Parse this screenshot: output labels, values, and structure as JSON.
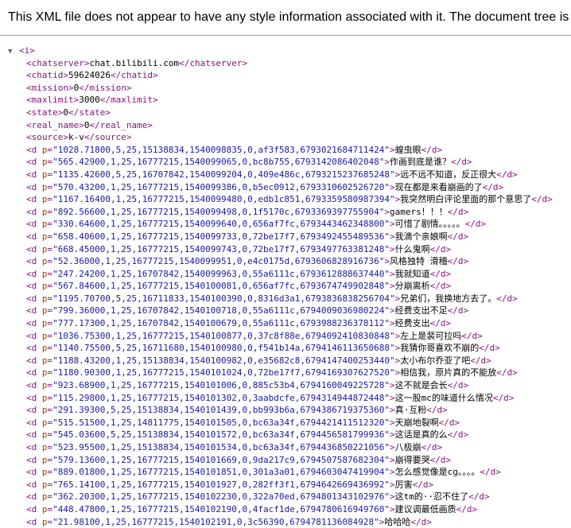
{
  "notice": "This XML file does not appear to have any style information associated with it. The document tree is shown below.",
  "root": {
    "open": "<i>",
    "toggle": "▼"
  },
  "fields": [
    {
      "tag": "chatserver",
      "value": "chat.bilibili.com"
    },
    {
      "tag": "chatid",
      "value": "59624026"
    },
    {
      "tag": "mission",
      "value": "0"
    },
    {
      "tag": "maxlimit",
      "value": "3000"
    },
    {
      "tag": "state",
      "value": "0"
    },
    {
      "tag": "real_name",
      "value": "0"
    },
    {
      "tag": "source",
      "value": "k-v"
    }
  ],
  "danmaku": [
    {
      "p": "1028.71800,5,25,15138834,1540098835,0,af3f583,6793021684711424",
      "text": "蝗虫眼"
    },
    {
      "p": "565.42900,1,25,16777215,1540099065,0,bc8b755,6793142086402048",
      "text": "作画到底是谁？"
    },
    {
      "p": "1135.42600,5,25,16707842,1540099204,0,409e486c,6793215237685248",
      "text": "远不远不知道，反正很大"
    },
    {
      "p": "570.43200,1,25,16777215,1540099386,0,b5ec0912,6793310602526720",
      "text": "现在都是来看崩画的了"
    },
    {
      "p": "1167.16400,1,25,16777215,1540099480,0,edb1c851,6793359580987394",
      "text": "我突然明白评论里面的那个意思了"
    },
    {
      "p": "892.56600,1,25,16777215,1540099498,0,1f5170c,6793369397755904",
      "text": "gamers！！！"
    },
    {
      "p": "330.64600,1,25,16777215,1540099640,0,656af7fc,6793443462348800",
      "text": "可惜了剧情。。。。。"
    },
    {
      "p": "658.40600,1,25,16777215,1540099733,0,72be17f7,6793492455489536",
      "text": "我滴个亲娘啊"
    },
    {
      "p": "668.45000,1,25,16777215,1540099743,0,72be17f7,6793497763381248",
      "text": "什么鬼啊"
    },
    {
      "p": "52.36000,1,25,16777215,1540099951,0,e4c0175d,6793606828916736",
      "text": "风格独特 滑稽"
    },
    {
      "p": "247.24200,1,25,16707842,1540099963,0,55a6111c,6793612888637440",
      "text": "我就知道"
    },
    {
      "p": "567.84600,1,25,16777215,1540100081,0,656af7fc,6793674749902848",
      "text": "分崩离析"
    },
    {
      "p": "1195.70700,5,25,16711833,1540100390,0,8316d3a1,6793836838256704",
      "text": "兄弟们，我换地方去了。"
    },
    {
      "p": "799.36000,1,25,16707842,1540100718,0,55a6111c,6794009036980224",
      "text": "经费支出不足"
    },
    {
      "p": "777.17300,1,25,16707842,1540100679,0,55a6111c,6793988236378112",
      "text": "经费支出"
    },
    {
      "p": "1036.75300,1,25,16777215,1540100877,0,37c8f88e,6794092410830848",
      "text": "左上是裴可拉吗"
    },
    {
      "p": "1140.75500,5,25,16711680,1540100980,0,f541b14a,6794146113650688",
      "text": "我猜你哥喜欢不崩的"
    },
    {
      "p": "1188.43200,1,25,15138834,1540100982,0,e35682c8,6794147400253440",
      "text": "太小布尔乔亚了吧"
    },
    {
      "p": "1180.90300,1,25,16777215,1540101024,0,72be17f7,6794169307627520",
      "text": "相信我，原片真的不能放"
    },
    {
      "p": "923.68900,1,25,16777215,1540101006,0,885c53b4,6794160049225728",
      "text": "这不就是会长"
    },
    {
      "p": "115.29800,1,25,16777215,1540101302,0,3aabdcfe,6794314944872448",
      "text": "这一股mc的味道什么情况"
    },
    {
      "p": "291.39300,5,25,15138834,1540101439,0,bb993b6a,6794386719375360",
      "text": "真·互粉"
    },
    {
      "p": "515.51500,1,25,14811775,1540101505,0,bc63a34f,6794421411512320",
      "text": "天崩地裂啊"
    },
    {
      "p": "545.03600,5,25,15138834,1540101572,0,bc63a34f,6794456581799936",
      "text": "这话是真的么"
    },
    {
      "p": "523.95500,1,25,15138834,1540101534,0,bc63a34f,6794436850221056",
      "text": "八极崩"
    },
    {
      "p": "579.13600,1,25,16777215,1540101669,0,9da217c9,6794507587682304",
      "text": "崩得要哭"
    },
    {
      "p": "889.01800,1,25,16777215,1540101851,0,301a3a01,6794603047419904",
      "text": "怎么感觉像是cg。。。。"
    },
    {
      "p": "765.14100,1,25,16777215,1540101927,0,282ff3f1,6794642669436992",
      "text": "厉害"
    },
    {
      "p": "362.20300,1,25,16777215,1540102230,0,322a70ed,6794801343102976",
      "text": "这tm的··忍不住了"
    },
    {
      "p": "448.47800,1,25,16777215,1540102190,0,4facf1de,6794780616949760",
      "text": "建议调最低画质"
    },
    {
      "p": "21.98100,1,25,16777215,1540102191,0,3c56390,6794781136084928",
      "text": "哈哈哈"
    }
  ]
}
